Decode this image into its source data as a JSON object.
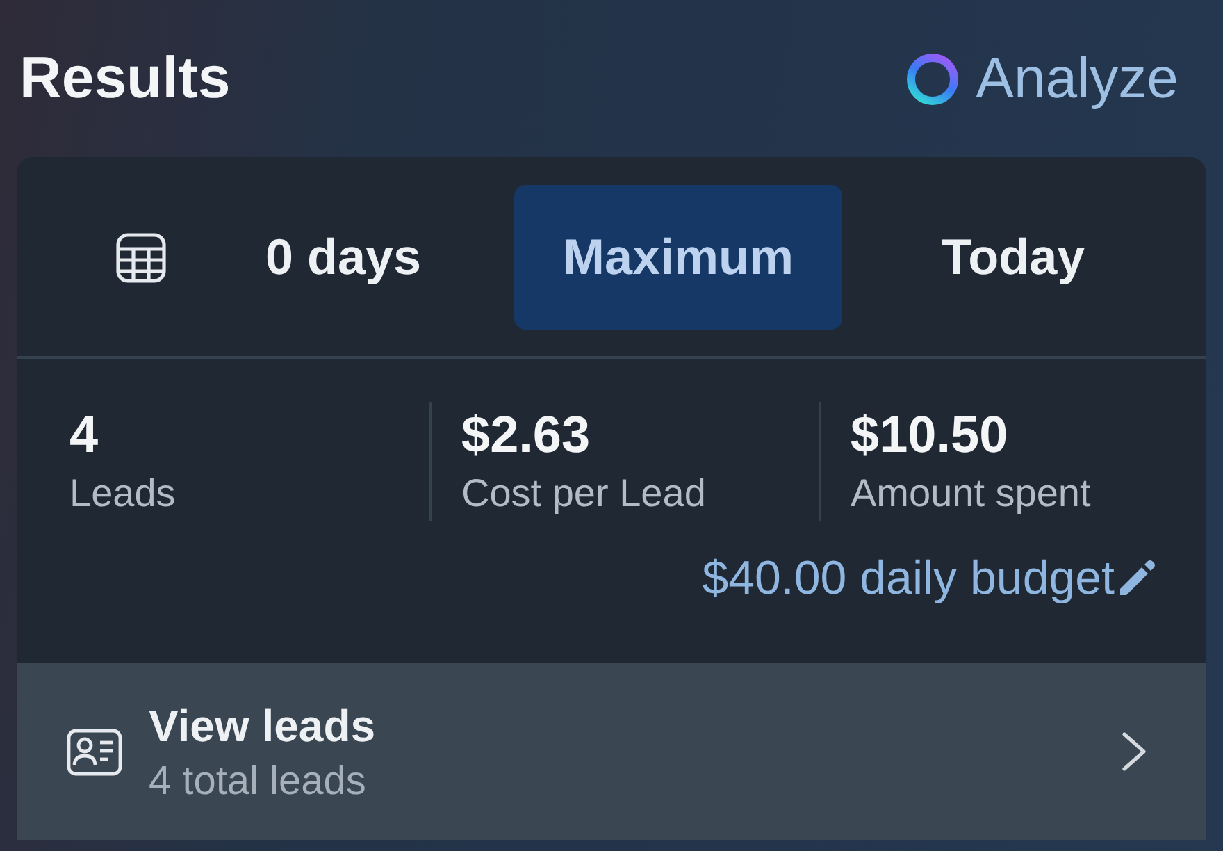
{
  "header": {
    "title": "Results",
    "analyze_button": "Analyze"
  },
  "date_range": {
    "tabs": [
      {
        "label": "0 days",
        "selected": false
      },
      {
        "label": "Maximum",
        "selected": true
      },
      {
        "label": "Today",
        "selected": false
      }
    ]
  },
  "metrics": [
    {
      "value": "4",
      "label": "Leads"
    },
    {
      "value": "$2.63",
      "label": "Cost per Lead"
    },
    {
      "value": "$10.50",
      "label": "Amount spent"
    }
  ],
  "budget_link": "$40.00 daily budget",
  "leads_row": {
    "title": "View leads",
    "subtitle": "4 total leads"
  }
}
